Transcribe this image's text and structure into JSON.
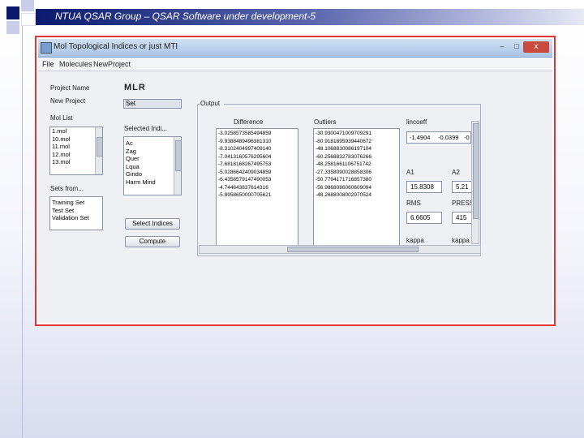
{
  "slide": {
    "title": "NTUA QSAR Group – QSAR Software under development-5"
  },
  "window": {
    "title": "Mol Topological Indices or just MTI",
    "min_symbol": "–",
    "max_symbol": "□",
    "close_symbol": "x"
  },
  "menu": [
    "File",
    "Molecules",
    "NewProject"
  ],
  "left": {
    "project_name_label": "Project Name",
    "project_name_value": "MLR",
    "new_project_label": "New Project",
    "set_button": "Set",
    "mol_list_label": "Mol List",
    "mol_list": [
      "1.mol",
      "10.mol",
      "11.mol",
      "12.mol",
      "13.mol"
    ],
    "selected_indices_label": "Selected Indi...",
    "selected_indices": [
      "Ac",
      "Zag",
      "Quer",
      "Lqua",
      "Gindo",
      "Harm Mind"
    ],
    "sets_label": "Sets from...",
    "sets": [
      "Training Set",
      "Test Set",
      "Validation Set"
    ],
    "select_indices_button": "Select Indices",
    "compute_button": "Compute"
  },
  "output": {
    "label": "Output",
    "difference_header": "Difference",
    "difference_values": [
      "-3.0258573585494859",
      "-9.9388489496381310",
      "-8.3102404997409140",
      "-7.0413160576295604",
      "-7.6818168267495753",
      "-5.0286642409034859",
      "-6.4358579147490053",
      "-4.744643837614316",
      "-5.8958650000705621"
    ],
    "outliers_header": "Outliers",
    "outliers_values": [
      "-30.9300471009709291",
      "-80.9181895939440672",
      "-48.1068830086197104",
      "-60.2568832783076266",
      "-48.2581661106751742",
      "-27.3358090028858306",
      "-50.7794171716857380",
      "-56.9868086060609094",
      "-48.2688008002970524"
    ],
    "lincoeff_label": "lincoeff",
    "lincoeff_values": [
      "-1.4904",
      "-0.0399",
      "-0"
    ],
    "a1_label": "A1",
    "a1_value": "15.8308",
    "a2_label": "A2",
    "a2_value": "5.21",
    "rms_label": "RMS",
    "rms_value": "6.6605",
    "press_label": "PRESS",
    "press_value": "415",
    "kappa_label": "kappa",
    "kappa2_label": "kappa"
  }
}
